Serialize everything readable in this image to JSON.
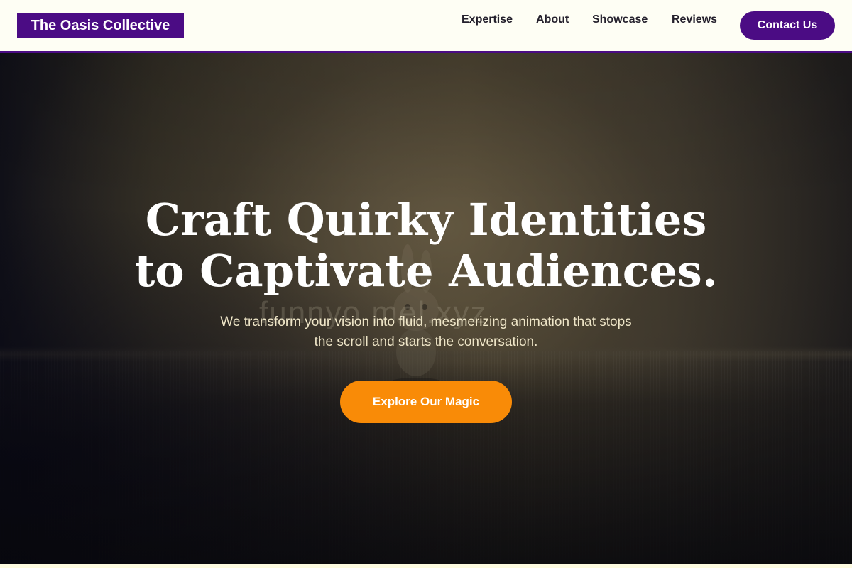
{
  "header": {
    "logo_text": "The Oasis Collective",
    "nav": {
      "expertise": "Expertise",
      "about": "About",
      "showcase": "Showcase",
      "reviews": "Reviews"
    },
    "contact_label": "Contact Us"
  },
  "hero": {
    "title_line1": "Craft Quirky Identities",
    "title_line2": "to Captivate Audiences.",
    "subtitle_line1": "We transform your vision into fluid, mesmerizing animation that stops",
    "subtitle_line2": "the scroll and starts the conversation.",
    "cta_label": "Explore Our Magic",
    "watermark_text": "funnyo  mel.xyz"
  },
  "colors": {
    "brand_purple": "#4b0c84",
    "cta_orange": "#f98b07",
    "header_bg": "#fefef4",
    "subtitle_text": "#efe6c8"
  },
  "icons": {
    "hero_figure": "bunny-figurine-image"
  }
}
